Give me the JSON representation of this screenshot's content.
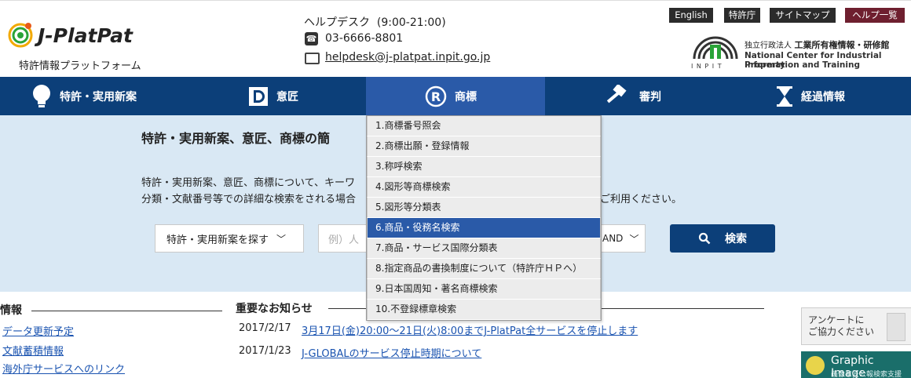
{
  "header": {
    "logo_text": "J-PlatPat",
    "logo_subtitle": "特許情報プラットフォーム",
    "helpdesk_title": "ヘルプデスク",
    "helpdesk_hours": "(9:00-21:00)",
    "phone": "03-6666-8801",
    "email": "helpdesk@j-platpat.inpit.go.jp",
    "top_links": [
      "English",
      "特許庁",
      "サイトマップ",
      "ヘルプ一覧"
    ],
    "inpit_name_jp_small": "独立行政法人",
    "inpit_name_jp": "工業所有権情報・研修館",
    "inpit_name_en_1": "National Center for Industrial Property",
    "inpit_name_en_2": "Information and Training",
    "inpit_abbr": "I N P I T"
  },
  "nav": {
    "items": [
      {
        "label": "特許・実用新案",
        "icon": "lightbulb-icon"
      },
      {
        "label": "意匠",
        "icon": "design-d-icon"
      },
      {
        "label": "商標",
        "icon": "registered-r-icon"
      },
      {
        "label": "審判",
        "icon": "gavel-icon"
      },
      {
        "label": "経過情報",
        "icon": "hourglass-icon"
      }
    ],
    "active_index": 2
  },
  "dropdown": {
    "items": [
      "1.商標番号照会",
      "2.商標出願・登録情報",
      "3.称呼検索",
      "4.図形等商標検索",
      "5.図形等分類表",
      "6.商品・役務名検索",
      "7.商品・サービス国際分類表",
      "8.指定商品の書換制度について（特許庁ＨＰへ）",
      "9.日本国周知・著名商標検索",
      "10.不登録標章検索"
    ],
    "highlighted_index": 5
  },
  "main": {
    "title": "特許・実用新案、意匠、商標の簡",
    "desc_line1": "特許・実用新案、意匠、商標について、キーワ",
    "desc_line2_left": "分類・文献番号等での詳細な検索をされる場合",
    "desc_line2_right": "ご利用ください。",
    "search_select": "特許・実用新案を探す",
    "search_placeholder": "例）人",
    "and_select": "AND",
    "search_button": "検索"
  },
  "left_panel": {
    "heading": "情報",
    "links": [
      "データ更新予定",
      "文献蓄積情報",
      "海外庁サービスへのリンク"
    ]
  },
  "notices": {
    "heading": "重要なお知らせ",
    "items": [
      {
        "date": "2017/2/17",
        "text": "3月17日(金)20:00～21日(火)8:00までJ-PlatPat全サービスを停止します"
      },
      {
        "date": "2017/1/23",
        "text": "J-GLOBALのサービス停止時期について"
      }
    ]
  },
  "side_banners": {
    "survey_line1": "アンケートに",
    "survey_line2": "ご協力ください",
    "graphic_title": "Graphic Image",
    "graphic_sub": "画像意匠公報検索支援"
  },
  "colors": {
    "nav_bg": "#0c3f79",
    "nav_active": "#2a5aa8",
    "band_bg": "#d9e8f4",
    "link": "#1a53b0",
    "help_red": "#6e1f2f"
  }
}
